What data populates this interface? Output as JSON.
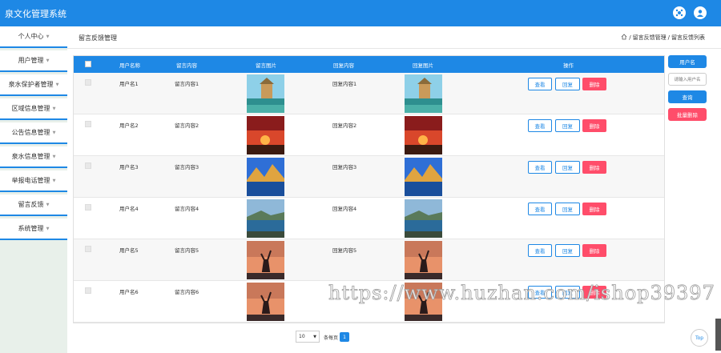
{
  "app": {
    "title": "泉文化管理系统"
  },
  "header_icons": [
    "settings-icon",
    "user-icon"
  ],
  "sidebar": {
    "items": [
      {
        "label": "个人中心"
      },
      {
        "label": "用户管理"
      },
      {
        "label": "泉水保护者管理"
      },
      {
        "label": "区域信息管理"
      },
      {
        "label": "公告信息管理"
      },
      {
        "label": "泉水信息管理"
      },
      {
        "label": "举报电话管理"
      },
      {
        "label": "留言反馈"
      },
      {
        "label": "系统管理"
      }
    ]
  },
  "page": {
    "title": "留言反馈管理",
    "breadcrumb": [
      "留言反馈管理",
      "留言反馈列表"
    ]
  },
  "table": {
    "columns": [
      "用户名称",
      "留言内容",
      "留言图片",
      "回复内容",
      "回复图片",
      "操作"
    ],
    "rows": [
      {
        "user": "用户名1",
        "message": "留言内容1",
        "reply": "回复内容1"
      },
      {
        "user": "用户名2",
        "message": "留言内容2",
        "reply": "回复内容2"
      },
      {
        "user": "用户名3",
        "message": "留言内容3",
        "reply": "回复内容3"
      },
      {
        "user": "用户名4",
        "message": "留言内容4",
        "reply": "回复内容4"
      },
      {
        "user": "用户名5",
        "message": "留言内容5",
        "reply": "回复内容5"
      },
      {
        "user": "用户名6",
        "message": "留言内容6",
        "reply": ""
      }
    ],
    "actions": {
      "view": "查看",
      "reply": "回复",
      "delete": "删除"
    }
  },
  "search": {
    "field_label": "用户名",
    "placeholder": "请输入用户名",
    "query_button": "查询",
    "batch_delete_button": "批量删除"
  },
  "pagination": {
    "page_size": "10",
    "page_size_label": "条每页",
    "current_page": "1"
  },
  "top_button": "Top",
  "watermark": "https://www.huzhan.com/ishop39397",
  "colors": {
    "primary": "#1e88e5",
    "danger": "#ff4d6a"
  }
}
